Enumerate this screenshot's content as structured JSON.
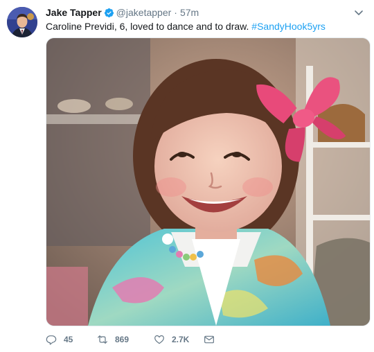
{
  "tweet": {
    "author_name": "Jake Tapper",
    "handle": "@jaketapper",
    "separator": "·",
    "time": "57m",
    "text": "Caroline Previdi, 6, loved to dance and to draw.",
    "hashtag": "#SandyHook5yrs",
    "verified_icon": "verified-badge-icon",
    "colors": {
      "hashtag": "#1da1f2",
      "verified": "#1da1f2",
      "muted": "#657786"
    }
  },
  "actions": {
    "reply_count": "45",
    "retweet_count": "869",
    "like_count": "2.7K",
    "icons": [
      "reply-icon",
      "retweet-icon",
      "heart-icon",
      "envelope-icon"
    ]
  }
}
